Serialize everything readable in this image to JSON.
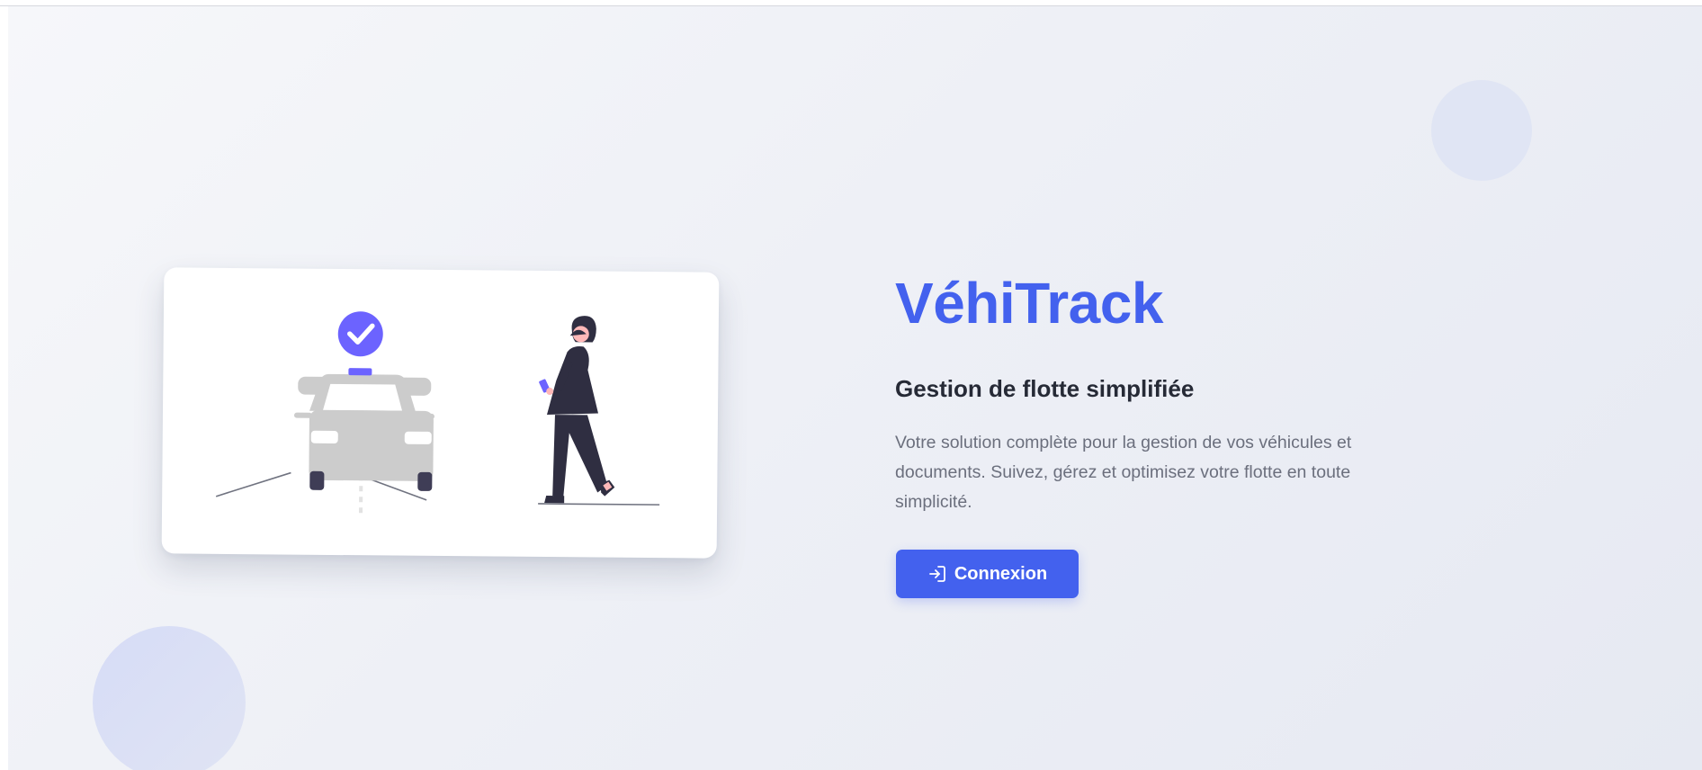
{
  "hero": {
    "title": "VéhiTrack",
    "subtitle": "Gestion de flotte simplifiée",
    "description": "Votre solution complète pour la gestion de vos véhicules et documents. Suivez, gérez et optimisez votre flotte en toute simplicité.",
    "login_button_label": "Connexion",
    "login_icon": "sign-in-icon"
  },
  "illustration": {
    "subject": "taxi-with-checkmark-and-walking-woman-icon"
  },
  "colors": {
    "accent": "#4361ee",
    "checkmark_badge": "#6c63ff",
    "heading": "#262a36",
    "body_text": "#6b6f7d",
    "car_gray": "#cccccc",
    "background": "#eef0f6"
  }
}
